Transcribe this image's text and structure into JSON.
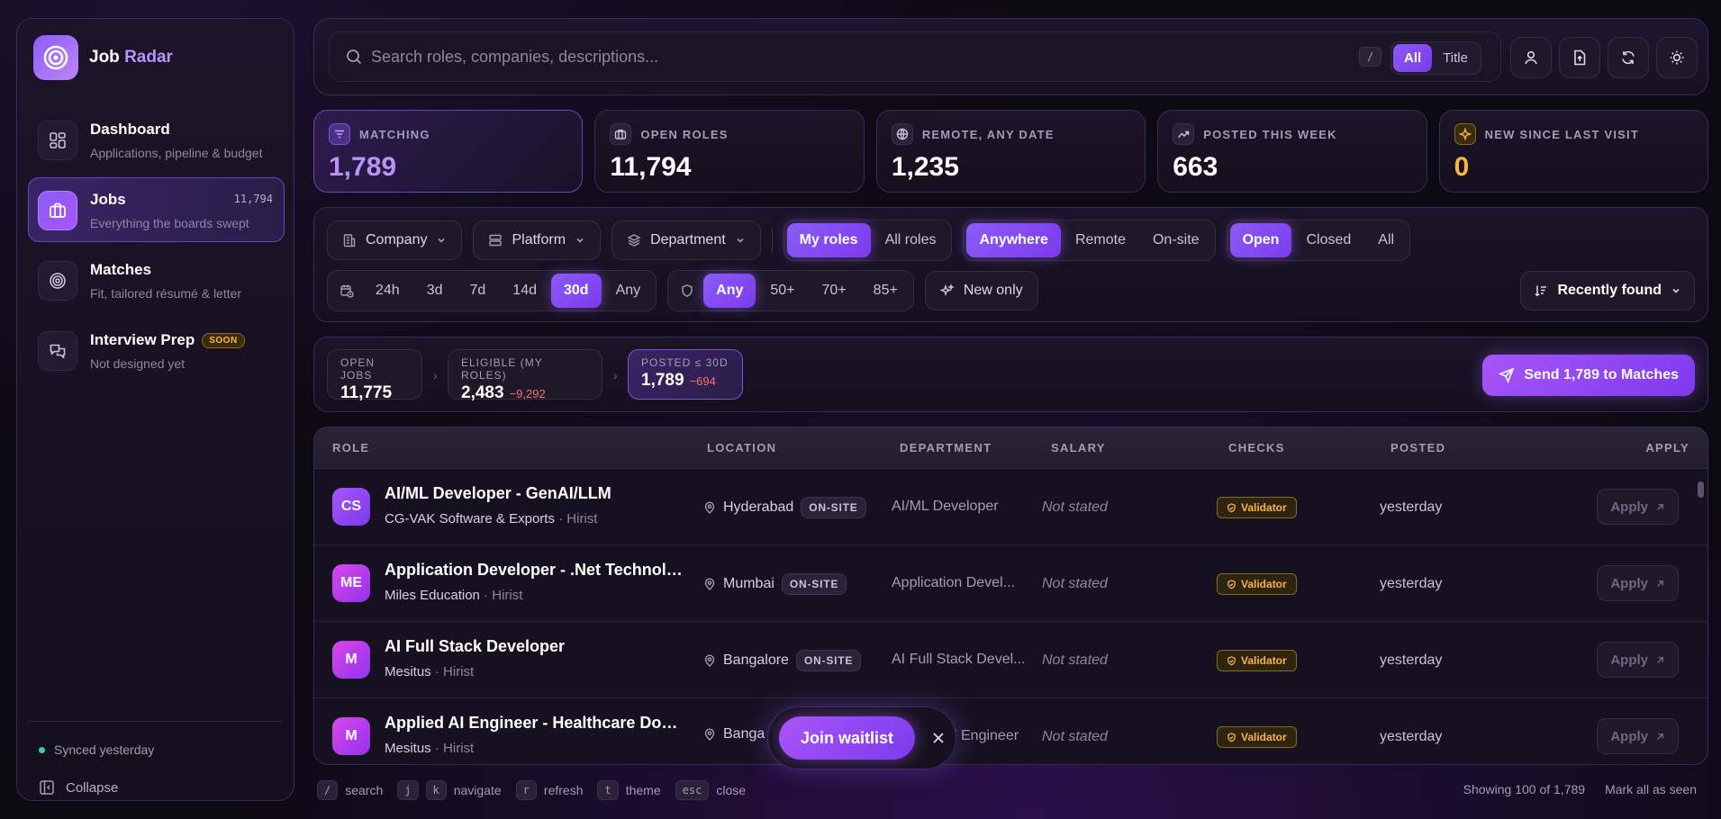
{
  "brand": {
    "name_part1": "Job",
    "name_part2": "Radar"
  },
  "nav": [
    {
      "title": "Dashboard",
      "sub": "Applications, pipeline & budget"
    },
    {
      "title": "Jobs",
      "sub": "Everything the boards swept",
      "count": "11,794"
    },
    {
      "title": "Matches",
      "sub": "Fit, tailored résumé & letter"
    },
    {
      "title": "Interview Prep",
      "sub": "Not designed yet",
      "badge": "SOON"
    }
  ],
  "sidebar_footer": {
    "synced": "Synced yesterday",
    "collapse": "Collapse"
  },
  "search": {
    "placeholder": "Search roles, companies, descriptions...",
    "shortcut": "/",
    "scope_options": [
      "All",
      "Title"
    ],
    "scope_selected": "All"
  },
  "stats": [
    {
      "label": "MATCHING",
      "value": "1,789",
      "icon": "filter-icon"
    },
    {
      "label": "OPEN ROLES",
      "value": "11,794",
      "icon": "briefcase-icon"
    },
    {
      "label": "REMOTE, ANY DATE",
      "value": "1,235",
      "icon": "globe-icon"
    },
    {
      "label": "POSTED THIS WEEK",
      "value": "663",
      "icon": "trend-up-icon"
    },
    {
      "label": "NEW SINCE LAST VISIT",
      "value": "0",
      "icon": "sparkle-icon"
    }
  ],
  "filters": {
    "company": "Company",
    "platform": "Platform",
    "department": "Department",
    "roles_scope": [
      "My roles",
      "All roles"
    ],
    "location_mode": [
      "Anywhere",
      "Remote",
      "On-site"
    ],
    "status": [
      "Open",
      "Closed",
      "All"
    ],
    "age": [
      "24h",
      "3d",
      "7d",
      "14d",
      "30d",
      "Any"
    ],
    "score": [
      "Any",
      "50+",
      "70+",
      "85+"
    ],
    "new_only": "New only",
    "sort": "Recently found"
  },
  "funnel": {
    "open_label": "OPEN JOBS",
    "open_value": "11,775",
    "eligible_label": "ELIGIBLE (MY ROLES)",
    "eligible_value": "2,483",
    "eligible_delta": "−9,292",
    "posted_label": "POSTED ≤ 30D",
    "posted_value": "1,789",
    "posted_delta": "−694",
    "send_label": "Send 1,789 to Matches"
  },
  "table": {
    "headers": {
      "role": "ROLE",
      "location": "LOCATION",
      "department": "DEPARTMENT",
      "salary": "SALARY",
      "checks": "CHECKS",
      "posted": "POSTED",
      "apply": "APPLY"
    },
    "rows": [
      {
        "initials": "CS",
        "title": "AI/ML Developer - GenAI/LLM",
        "company": "CG-VAK Software & Exports",
        "source": "Hirist",
        "location": "Hyderabad",
        "mode": "ON-SITE",
        "department": "AI/ML Developer",
        "salary": "Not stated",
        "check": "Validator",
        "posted": "yesterday",
        "apply": "Apply"
      },
      {
        "initials": "ME",
        "title": "Application Developer - .Net Technolog...",
        "company": "Miles Education",
        "source": "Hirist",
        "location": "Mumbai",
        "mode": "ON-SITE",
        "department": "Application Devel...",
        "salary": "Not stated",
        "check": "Validator",
        "posted": "yesterday",
        "apply": "Apply"
      },
      {
        "initials": "M",
        "title": "AI Full Stack Developer",
        "company": "Mesitus",
        "source": "Hirist",
        "location": "Bangalore",
        "mode": "ON-SITE",
        "department": "AI Full Stack Devel...",
        "salary": "Not stated",
        "check": "Validator",
        "posted": "yesterday",
        "apply": "Apply"
      },
      {
        "initials": "M",
        "title": "Applied AI Engineer - Healthcare Domain",
        "company": "Mesitus",
        "source": "Hirist",
        "location": "Banga",
        "department": "l Engineer",
        "salary": "Not stated",
        "check": "Validator",
        "posted": "yesterday",
        "apply": "Apply"
      }
    ]
  },
  "waitlist": {
    "label": "Join waitlist"
  },
  "footer": {
    "hints": [
      {
        "keys": [
          "/"
        ],
        "label": "search"
      },
      {
        "keys": [
          "j",
          "k"
        ],
        "label": "navigate"
      },
      {
        "keys": [
          "r"
        ],
        "label": "refresh"
      },
      {
        "keys": [
          "t"
        ],
        "label": "theme"
      },
      {
        "keys": [
          "esc"
        ],
        "label": "close"
      }
    ],
    "showing": "Showing 100 of 1,789",
    "mark_seen": "Mark all as seen"
  }
}
